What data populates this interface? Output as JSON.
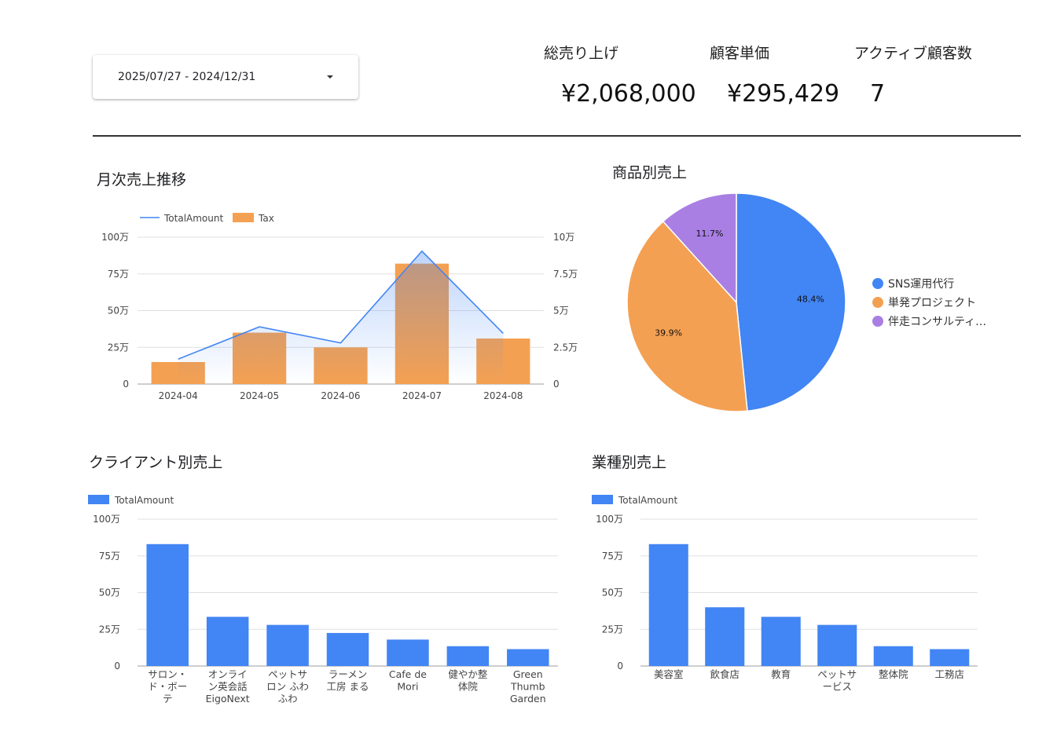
{
  "date_range": {
    "label": "2025/07/27 - 2024/12/31"
  },
  "kpis": [
    {
      "label": "総売り上げ",
      "value": "¥2,068,000"
    },
    {
      "label": "顧客単価",
      "value": "¥295,429"
    },
    {
      "label": "アクティブ顧客数",
      "value": "7"
    }
  ],
  "sections": {
    "monthly": "月次売上推移",
    "product": "商品別売上",
    "client": "クライアント別売上",
    "industry": "業種別売上"
  },
  "colors": {
    "blue": "#4285f4",
    "orange": "#f4a052",
    "purple": "#a97fe4",
    "grid": "#e0e0e0",
    "axis": "#9e9e9e"
  },
  "chart_data": [
    {
      "type": "bar+line",
      "title": "月次売上推移",
      "categories": [
        "2024-04",
        "2024-05",
        "2024-06",
        "2024-07",
        "2024-08"
      ],
      "series": [
        {
          "name": "TotalAmount",
          "type": "line",
          "axis": "left",
          "values": [
            170000,
            390000,
            280000,
            905000,
            345000
          ]
        },
        {
          "name": "Tax",
          "type": "bar",
          "axis": "right",
          "values": [
            15000,
            35000,
            25000,
            82000,
            31000
          ]
        }
      ],
      "y_left": {
        "min": 0,
        "max": 1000000,
        "ticks": [
          0,
          250000,
          500000,
          750000,
          1000000
        ],
        "tick_labels": [
          "0",
          "25万",
          "50万",
          "75万",
          "100万"
        ]
      },
      "y_right": {
        "min": 0,
        "max": 100000,
        "ticks": [
          0,
          25000,
          50000,
          75000,
          100000
        ],
        "tick_labels": [
          "0",
          "2.5万",
          "5万",
          "7.5万",
          "10万"
        ]
      },
      "legend": "top-left",
      "grid": true
    },
    {
      "type": "pie",
      "title": "商品別売上",
      "slices": [
        {
          "name": "SNS運用代行",
          "value": 48.4,
          "label": "48.4%"
        },
        {
          "name": "単発プロジェクト",
          "value": 39.9,
          "label": "39.9%"
        },
        {
          "name": "伴走コンサルティ…",
          "value": 11.7,
          "label": "11.7%"
        }
      ],
      "legend": "right"
    },
    {
      "type": "bar",
      "title": "クライアント別売上",
      "categories": [
        "サロン・ド・ボーテ",
        "オンライン英会話 EigoNext",
        "ペットサロン ふわふわ",
        "ラーメン工房 まる",
        "Cafe de Mori",
        "健やか整体院",
        "Green Thumb Garden"
      ],
      "category_lines": [
        [
          "サロン・",
          "ド・ボー",
          "テ"
        ],
        [
          "オンライ",
          "ン英会話",
          "EigoNext"
        ],
        [
          "ペットサ",
          "ロン ふわ",
          "ふわ"
        ],
        [
          "ラーメン",
          "工房 まる"
        ],
        [
          "Cafe de",
          "Mori"
        ],
        [
          "健やか整",
          "体院"
        ],
        [
          "Green",
          "Thumb",
          "Garden"
        ]
      ],
      "series": [
        {
          "name": "TotalAmount",
          "values": [
            830000,
            335000,
            280000,
            225000,
            180000,
            135000,
            115000
          ]
        }
      ],
      "y": {
        "min": 0,
        "max": 1000000,
        "ticks": [
          0,
          250000,
          500000,
          750000,
          1000000
        ],
        "tick_labels": [
          "0",
          "25万",
          "50万",
          "75万",
          "100万"
        ]
      },
      "legend": "top-left",
      "grid": true
    },
    {
      "type": "bar",
      "title": "業種別売上",
      "categories": [
        "美容室",
        "飲食店",
        "教育",
        "ペットサービス",
        "整体院",
        "工務店"
      ],
      "category_lines": [
        [
          "美容室"
        ],
        [
          "飲食店"
        ],
        [
          "教育"
        ],
        [
          "ペットサ",
          "ービス"
        ],
        [
          "整体院"
        ],
        [
          "工務店"
        ]
      ],
      "series": [
        {
          "name": "TotalAmount",
          "values": [
            830000,
            400000,
            335000,
            280000,
            135000,
            115000
          ]
        }
      ],
      "y": {
        "min": 0,
        "max": 1000000,
        "ticks": [
          0,
          250000,
          500000,
          750000,
          1000000
        ],
        "tick_labels": [
          "0",
          "25万",
          "50万",
          "75万",
          "100万"
        ]
      },
      "legend": "top-left",
      "grid": true
    }
  ]
}
